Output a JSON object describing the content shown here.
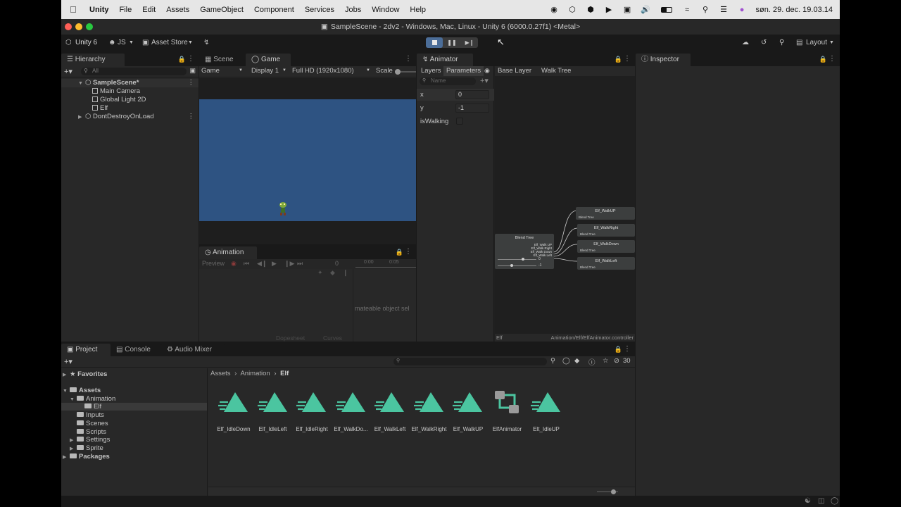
{
  "menubar": {
    "items": [
      "Unity",
      "File",
      "Edit",
      "Assets",
      "GameObject",
      "Component",
      "Services",
      "Jobs",
      "Window",
      "Help"
    ],
    "clock": "søn. 29. dec.  19.03.14"
  },
  "window": {
    "title": "SampleScene - 2dv2 - Windows, Mac, Linux - Unity 6 (6000.0.27f1) <Metal>"
  },
  "toolbar": {
    "account": "Unity 6",
    "user": "JS",
    "asset_store": "Asset Store",
    "layout": "Layout"
  },
  "hierarchy": {
    "tab": "Hierarchy",
    "search_placeholder": "All",
    "scene": "SampleScene*",
    "children": [
      "Main Camera",
      "Global Light 2D",
      "Elf"
    ],
    "dont_destroy": "DontDestroyOnLoad"
  },
  "game": {
    "tab_scene": "Scene",
    "tab_game": "Game",
    "mode": "Game",
    "display": "Display 1",
    "resolution": "Full HD (1920x1080)",
    "scale_label": "Scale",
    "bg_color": "#2e5382"
  },
  "animation": {
    "tab": "Animation",
    "preview": "Preview",
    "frame": "0",
    "ticks": [
      "0:00",
      "0:05"
    ],
    "message": "mateable object sel",
    "dopesheet": "Dopesheet",
    "curves": "Curves"
  },
  "animator": {
    "tab": "Animator",
    "layers_tab": "Layers",
    "parameters_tab": "Parameters",
    "search_placeholder": "Name",
    "breadcrumb": [
      "Base Layer",
      "Walk Tree"
    ],
    "params": [
      {
        "name": "x",
        "value": "0"
      },
      {
        "name": "y",
        "value": "-1"
      },
      {
        "name": "isWalking",
        "value": ""
      }
    ],
    "blend_node": {
      "title": "Blend Tree",
      "ports": [
        "Elf_Walk UP",
        "Elf_Walk Right",
        "Elf_Walk Down",
        "Elf_Walk Left"
      ],
      "values": [
        "0",
        "-1"
      ]
    },
    "child_nodes": [
      {
        "title": "Elf_WalkUP",
        "sub": "Blend Tree"
      },
      {
        "title": "Elf_WalkRight",
        "sub": "Blend Tree"
      },
      {
        "title": "Elf_WalkDown",
        "sub": "Blend Tree"
      },
      {
        "title": "Elf_WalkLeft",
        "sub": "Blend Tree"
      }
    ],
    "footer_left": "Elf",
    "footer_right": "Animation/Elf/ElfAnimator.controller"
  },
  "inspector": {
    "tab": "Inspector"
  },
  "project": {
    "tab_project": "Project",
    "tab_console": "Console",
    "tab_audio": "Audio Mixer",
    "hidden_count": "30",
    "favorites": "Favorites",
    "assets": "Assets",
    "animation": "Animation",
    "elf": "Elf",
    "folders": [
      "Inputs",
      "Scenes",
      "Scripts",
      "Settings",
      "Sprite"
    ],
    "packages": "Packages",
    "breadcrumb": [
      "Assets",
      "Animation",
      "Elf"
    ],
    "files": [
      {
        "name": "Elf_IdleDown",
        "kind": "anim"
      },
      {
        "name": "Elf_IdleLeft",
        "kind": "anim"
      },
      {
        "name": "Elf_IdleRight",
        "kind": "anim"
      },
      {
        "name": "Elf_WalkDo...",
        "kind": "anim"
      },
      {
        "name": "Elf_WalkLeft",
        "kind": "anim"
      },
      {
        "name": "Elf_WalkRight",
        "kind": "anim"
      },
      {
        "name": "Elf_WalkUP",
        "kind": "anim"
      },
      {
        "name": "ElfAnimator",
        "kind": "controller"
      },
      {
        "name": "Elt_IdleUP",
        "kind": "anim"
      }
    ],
    "anim_icon_color": "#4bc5a0"
  }
}
